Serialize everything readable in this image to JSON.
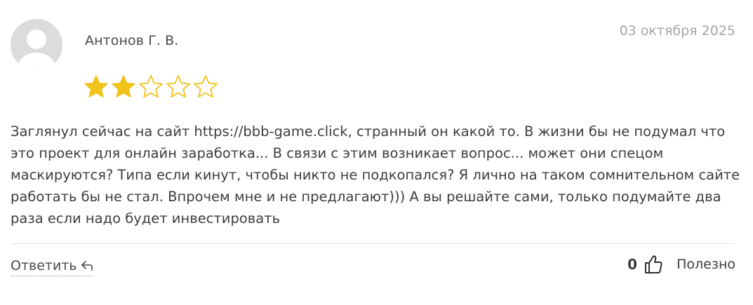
{
  "review": {
    "author": "Антонов Г. В.",
    "date": "03 октября 2025",
    "rating": 2,
    "rating_max": 5,
    "text": "Заглянул сейчас на сайт https://bbb-game.click, странный он какой то. В жизни бы не подумал что это проект для онлайн заработка... В связи с этим возникает вопрос... может они спецом маскируются? Типа если кинут, чтобы никто не подкопался? Я лично на таком сомнительном сайте работать бы не стал. Впрочем мне и не предлагают))) А вы решайте сами, только подумайте два раза если надо будет инвестировать"
  },
  "actions": {
    "reply_label": "Ответить",
    "reply_icon": "reply-arrow-icon",
    "likes_count": "0",
    "like_icon": "thumbs-up-icon",
    "helpful_label": "Полезно"
  },
  "colors": {
    "star_filled": "#f2c31b",
    "star_empty_stroke": "#f2c31b",
    "date": "#a5a5a5"
  }
}
